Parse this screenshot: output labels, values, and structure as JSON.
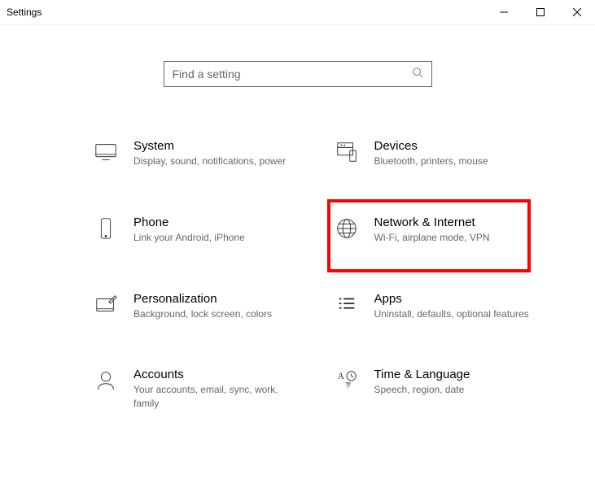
{
  "window": {
    "title": "Settings"
  },
  "search": {
    "placeholder": "Find a setting"
  },
  "categories": [
    {
      "id": "system",
      "title": "System",
      "desc": "Display, sound, notifications, power"
    },
    {
      "id": "devices",
      "title": "Devices",
      "desc": "Bluetooth, printers, mouse"
    },
    {
      "id": "phone",
      "title": "Phone",
      "desc": "Link your Android, iPhone"
    },
    {
      "id": "network",
      "title": "Network & Internet",
      "desc": "Wi-Fi, airplane mode, VPN",
      "highlighted": true
    },
    {
      "id": "personalization",
      "title": "Personalization",
      "desc": "Background, lock screen, colors"
    },
    {
      "id": "apps",
      "title": "Apps",
      "desc": "Uninstall, defaults, optional features"
    },
    {
      "id": "accounts",
      "title": "Accounts",
      "desc": "Your accounts, email, sync, work, family"
    },
    {
      "id": "time",
      "title": "Time & Language",
      "desc": "Speech, region, date"
    }
  ]
}
